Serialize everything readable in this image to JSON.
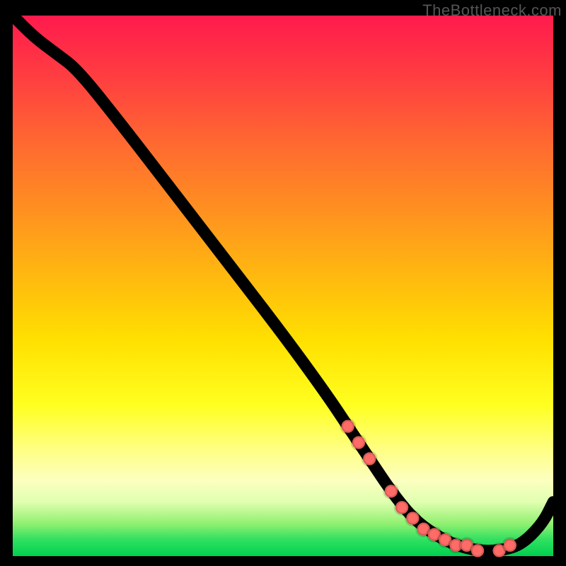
{
  "watermark": "TheBottleneck.com",
  "colors": {
    "frame_bg": "#000000",
    "marker": "#ff6b66",
    "curve": "#000000",
    "gradient_top": "#ff1a4d",
    "gradient_bottom": "#00d050"
  },
  "chart_data": {
    "type": "line",
    "title": "",
    "xlabel": "",
    "ylabel": "",
    "xlim": [
      0,
      100
    ],
    "ylim": [
      0,
      100
    ],
    "series": [
      {
        "name": "bottleneck-curve",
        "x": [
          0,
          4,
          8,
          12,
          20,
          30,
          40,
          50,
          58,
          62,
          66,
          70,
          74,
          78,
          82,
          86,
          90,
          94,
          98,
          100
        ],
        "y": [
          100,
          96,
          93,
          90,
          80,
          67,
          54,
          41,
          30,
          24,
          18,
          12,
          7,
          4,
          2,
          1,
          1,
          2,
          6,
          10
        ]
      }
    ],
    "markers": {
      "name": "highlighted-points",
      "x": [
        62,
        64,
        66,
        70,
        72,
        74,
        76,
        78,
        80,
        82,
        84,
        86,
        90,
        92
      ],
      "y": [
        24,
        21,
        18,
        12,
        9,
        7,
        5,
        4,
        3,
        2,
        2,
        1,
        1,
        2
      ]
    }
  }
}
